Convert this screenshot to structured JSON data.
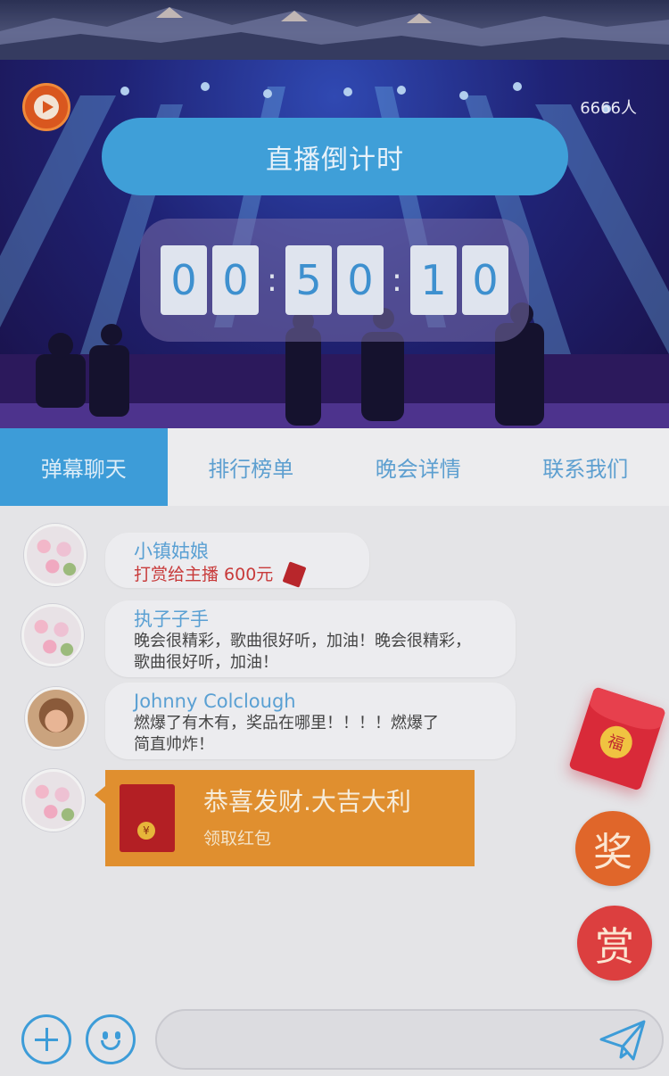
{
  "stage": {
    "viewers": "6666人",
    "countdown_title": "直播倒计时",
    "timer": {
      "h1": "0",
      "h2": "0",
      "m1": "5",
      "m2": "0",
      "s1": "1",
      "s2": "0",
      "sep": ":"
    }
  },
  "tabs": [
    {
      "label": "弹幕聊天",
      "active": true
    },
    {
      "label": "排行榜单",
      "active": false
    },
    {
      "label": "晚会详情",
      "active": false
    },
    {
      "label": "联系我们",
      "active": false
    }
  ],
  "messages": [
    {
      "name": "小镇姑娘",
      "gift": "打赏给主播 600元",
      "gift_icon": "red-envelope-icon"
    },
    {
      "name": "执子子手",
      "text_line1": "晚会很精彩，歌曲很好听，加油！晚会很精彩，",
      "text_line2": "歌曲很好听，加油！"
    },
    {
      "name": "Johnny Colclough",
      "text_line1": "燃爆了有木有，奖品在哪里！！！！燃爆了",
      "text_line2": "简直帅炸！"
    }
  ],
  "red_packet": {
    "title": "恭喜发财.大吉大利",
    "subtitle": "领取红包",
    "coin": "¥"
  },
  "floating": {
    "envelope_char": "福",
    "jiang": "奖",
    "shang": "赏"
  },
  "input": {
    "value": ""
  },
  "colors": {
    "accent": "#3d9cd8",
    "reward": "#dc3f3f",
    "prize": "#e0662a",
    "packet": "#e08f2f"
  }
}
